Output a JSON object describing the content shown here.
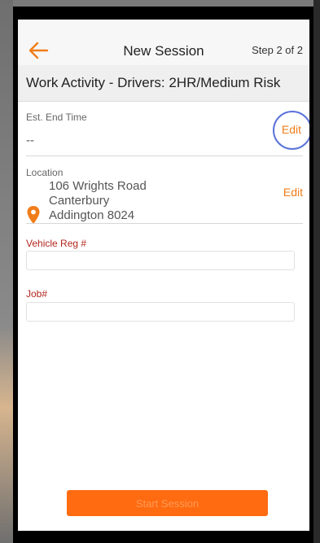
{
  "nav": {
    "title": "New Session",
    "step": "Step 2 of 2",
    "back_icon": "arrow-left-icon"
  },
  "activity": {
    "title": "Work Activity - Drivers: 2HR/Medium Risk"
  },
  "end_time": {
    "label": "Est. End Time",
    "value": "--",
    "edit_label": "Edit"
  },
  "location": {
    "label": "Location",
    "icon": "map-pin-icon",
    "address_lines": [
      "106 Wrights Road",
      "Canterbury",
      "Addington 8024"
    ],
    "edit_label": "Edit"
  },
  "fields": {
    "vehicle_reg_label": "Vehicle Reg #",
    "vehicle_reg_value": "",
    "job_label": "Job#",
    "job_value": ""
  },
  "start_button": {
    "label": "Start Session"
  },
  "colors": {
    "accent": "#f07d1a",
    "button": "#ff6b10",
    "required_label": "#b3261e",
    "highlight_ring": "#5b73d9"
  }
}
